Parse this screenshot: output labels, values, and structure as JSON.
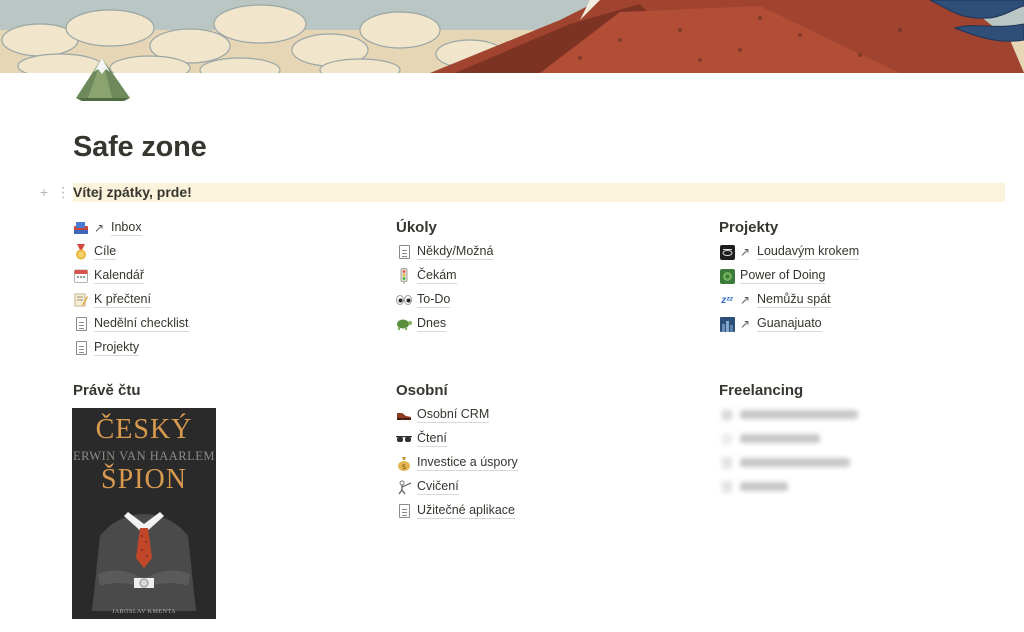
{
  "page": {
    "title": "Safe zone",
    "callout": "Vítej zpátky, prde!",
    "add_glyph": "+",
    "drag_glyph": "⋮⋮"
  },
  "columns": {
    "left_links": [
      {
        "icon": "inbox-tray-icon",
        "arrow": true,
        "label": "Inbox"
      },
      {
        "icon": "medal-icon",
        "arrow": false,
        "label": "Cíle"
      },
      {
        "icon": "calendar-icon",
        "arrow": false,
        "label": "Kalendář"
      },
      {
        "icon": "memo-icon",
        "arrow": false,
        "label": "K přečtení"
      },
      {
        "icon": "page-icon",
        "arrow": false,
        "label": "Nedělní checklist"
      },
      {
        "icon": "page-icon",
        "arrow": false,
        "label": "Projekty"
      }
    ],
    "ukoly": {
      "heading": "Úkoly",
      "items": [
        {
          "icon": "page-icon",
          "label": "Někdy/Možná"
        },
        {
          "icon": "vertical-traffic-light-icon",
          "label": "Čekám"
        },
        {
          "icon": "eyes-icon",
          "label": "To-Do"
        },
        {
          "icon": "turtle-icon",
          "label": "Dnes"
        }
      ]
    },
    "projekty": {
      "heading": "Projekty",
      "items": [
        {
          "icon": "loudavym-krokem-logo-icon",
          "label": "Loudavým krokem"
        },
        {
          "icon": "power-of-doing-logo-icon",
          "label": "Power of Doing"
        },
        {
          "icon": "zzz-icon",
          "label": "Nemůžu spát"
        },
        {
          "icon": "city-photo-icon",
          "label": "Guanajuato"
        }
      ]
    },
    "prave_ctu": {
      "heading": "Právě čtu",
      "book": {
        "title_line1": "ČESKÝ",
        "author_line": "ERWIN VAN HAARLEM",
        "title_line2": "ŠPION",
        "bottom_line": "JAROSLAV KMENTA"
      }
    },
    "osobni": {
      "heading": "Osobní",
      "items": [
        {
          "icon": "shoe-icon",
          "label": "Osobní CRM"
        },
        {
          "icon": "sunglasses-icon",
          "label": "Čtení"
        },
        {
          "icon": "money-bag-icon",
          "label": "Investice a úspory"
        },
        {
          "icon": "person-fencing-icon",
          "label": "Cvičení"
        },
        {
          "icon": "page-icon",
          "label": "Užitečné aplikace"
        }
      ]
    },
    "freelancing": {
      "heading": "Freelancing",
      "items_blurred": true
    }
  },
  "colors": {
    "callout_bg": "#fbf3db",
    "text": "#37352f",
    "book_title": "#d79a4f",
    "tie_red": "#c2472a"
  }
}
